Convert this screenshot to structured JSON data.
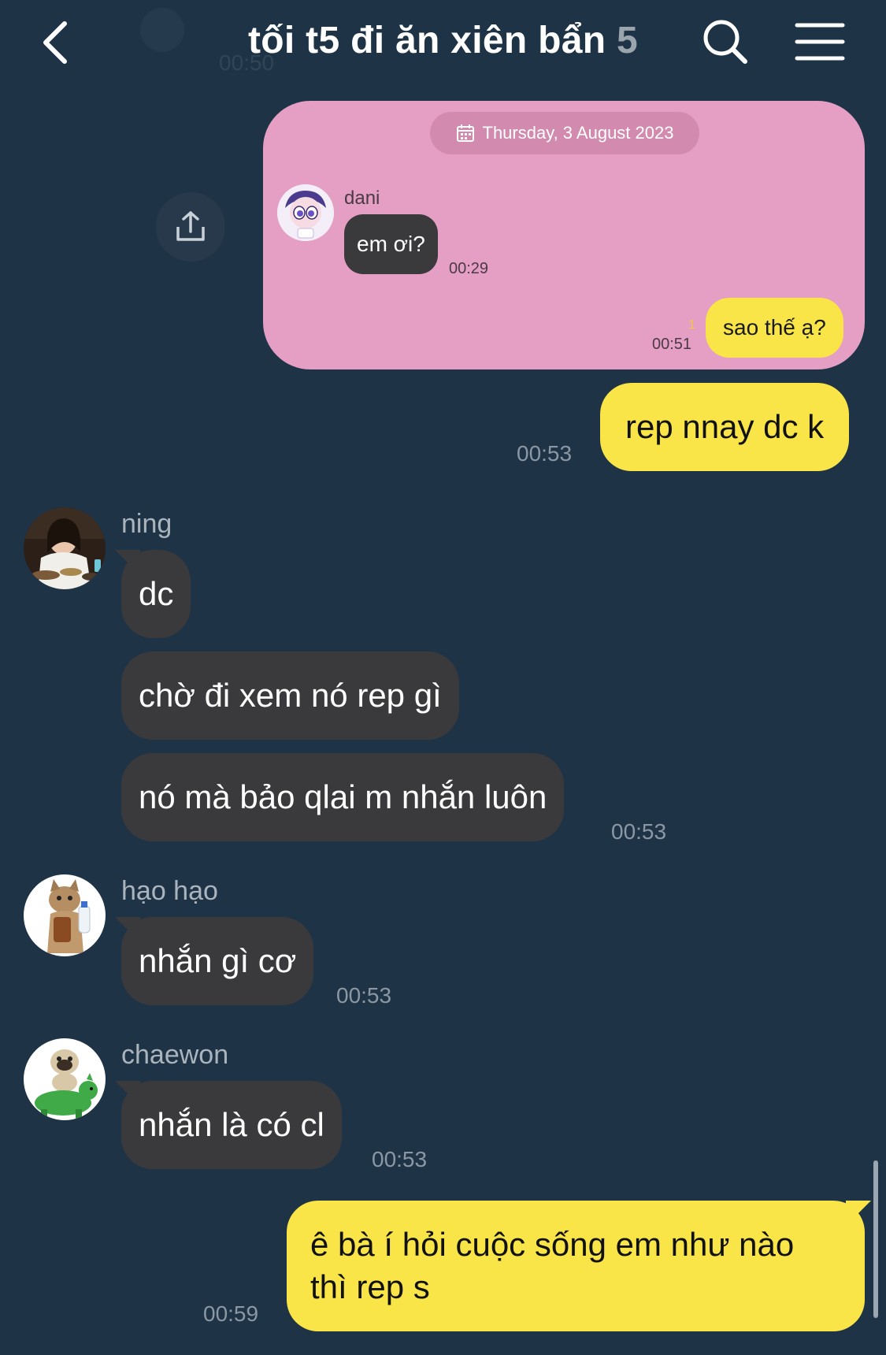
{
  "header": {
    "title": "tối t5 đi ăn xiên bẩn",
    "member_count": "5",
    "ghost_time": "00:50",
    "back_icon": "chevron-left-icon",
    "search_icon": "search-icon",
    "menu_icon": "hamburger-menu-icon"
  },
  "share": {
    "icon": "share-icon"
  },
  "quote": {
    "date": "Thursday, 3 August 2023",
    "sender": "dani",
    "message": "em ơi?",
    "message_time": "00:29",
    "reply_read_count": "1",
    "reply_time": "00:51",
    "reply": "sao thế ạ?",
    "colors": {
      "card": "#e59fc4",
      "pill": "#d28aae"
    }
  },
  "messages": [
    {
      "from": "me",
      "text": "rep nnay dc k",
      "time": "00:53"
    },
    {
      "from": "ning",
      "sender": "ning",
      "lines": [
        "dc",
        "chờ đi xem nó rep gì",
        "nó mà bảo qlai m nhắn luôn"
      ],
      "time": "00:53"
    },
    {
      "from": "hao",
      "sender": "hạo hạo",
      "lines": [
        "nhắn gì cơ"
      ],
      "time": "00:53"
    },
    {
      "from": "chaewon",
      "sender": "chaewon",
      "lines": [
        "nhắn là có cl"
      ],
      "time": "00:53"
    },
    {
      "from": "me",
      "text_line1": "ê bà í hỏi cuộc sống em như nào",
      "text_line2": "thì rep s",
      "time": "00:59"
    }
  ],
  "colors": {
    "background": "#1f3346",
    "my_bubble": "#f9e547",
    "their_bubble": "#3a3a3c",
    "timestamp": "#8b98a4"
  }
}
